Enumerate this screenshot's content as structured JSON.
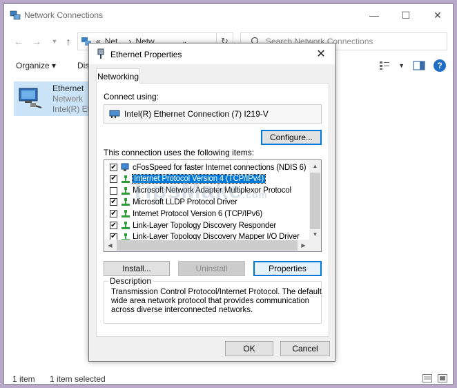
{
  "explorer": {
    "title": "Network Connections",
    "breadcrumb": [
      "«",
      "Net...",
      "›",
      "Netw..."
    ],
    "search_placeholder": "Search Network Connections",
    "organize_label": "Organize ▾",
    "dis_label": "Dis",
    "item": {
      "name": "Ethernet",
      "line2": "Network",
      "line3": "Intel(R) Eth"
    },
    "status_count": "1 item",
    "status_selected": "1 item selected"
  },
  "dialog": {
    "title": "Ethernet Properties",
    "tab_label": "Networking",
    "connect_using_label": "Connect using:",
    "adapter_name": "Intel(R) Ethernet Connection (7) I219-V",
    "configure_label": "Configure...",
    "items_label": "This connection uses the following items:",
    "items": [
      {
        "label": "cFosSpeed for faster Internet connections (NDIS 6)",
        "checked": true,
        "selected": false,
        "icon": "network-service-icon"
      },
      {
        "label": "Internet Protocol Version 4 (TCP/IPv4)",
        "checked": true,
        "selected": true,
        "icon": "protocol-icon"
      },
      {
        "label": "Microsoft Network Adapter Multiplexor Protocol",
        "checked": false,
        "selected": false,
        "icon": "protocol-icon"
      },
      {
        "label": "Microsoft LLDP Protocol Driver",
        "checked": true,
        "selected": false,
        "icon": "protocol-icon"
      },
      {
        "label": "Internet Protocol Version 6 (TCP/IPv6)",
        "checked": true,
        "selected": false,
        "icon": "protocol-icon"
      },
      {
        "label": "Link-Layer Topology Discovery Responder",
        "checked": true,
        "selected": false,
        "icon": "protocol-icon"
      },
      {
        "label": "Link-Layer Topology Discovery Mapper I/O Driver",
        "checked": true,
        "selected": false,
        "icon": "protocol-icon"
      }
    ],
    "install_label": "Install...",
    "uninstall_label": "Uninstall",
    "properties_label": "Properties",
    "description_legend": "Description",
    "description_text": "Transmission Control Protocol/Internet Protocol. The default wide area network protocol that provides communication across diverse interconnected networks.",
    "ok_label": "OK",
    "cancel_label": "Cancel",
    "watermark": "TipsMake",
    "watermark_suffix": ".com"
  },
  "colors": {
    "selection": "#0078d7",
    "backdrop": "#b9a8c9"
  }
}
